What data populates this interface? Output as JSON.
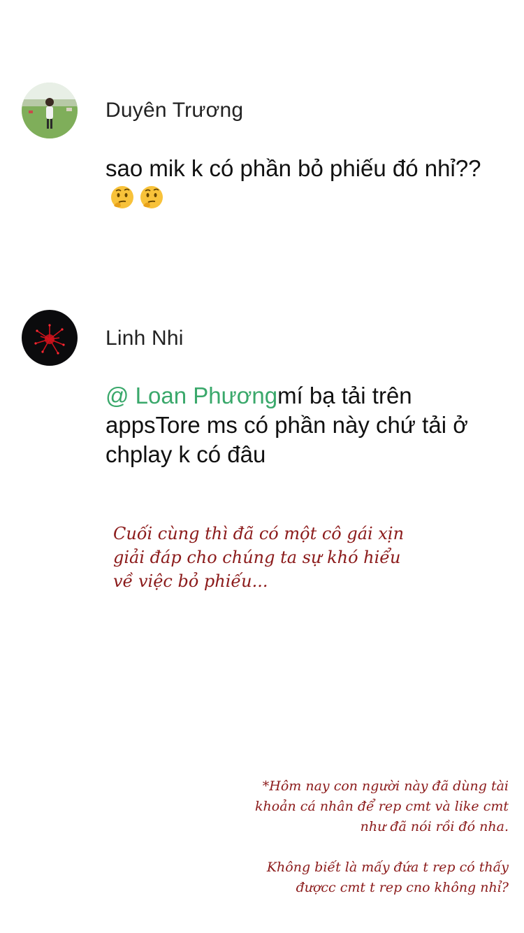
{
  "comments": [
    {
      "author": "Duyên Trương",
      "text": "sao mik k có phần bỏ phiếu đó nhỉ??",
      "emojis": [
        "thinking-face",
        "thinking-face"
      ]
    },
    {
      "author": "Linh Nhi",
      "mention": "@ Loan Phương",
      "text": "mí bạ tải trên appsTore ms có phần này chứ tải ở chplay k có đâu"
    }
  ],
  "caption": {
    "line1": "Cuối cùng thì đã có một cô gái xịn",
    "line2": "giải đáp cho chúng ta sự khó hiểu",
    "line3": "về việc bỏ phiếu..."
  },
  "note": {
    "line1": "*Hôm nay con người này đã dùng tài",
    "line2": "khoản cá nhân để rep cmt và like cmt",
    "line3": "như đã nói rồi đó nha.",
    "line4": "Không biết là mấy đứa t rep có thấy",
    "line5": "đượcc cmt t rep cno không nhỉ?"
  },
  "colors": {
    "mention": "#3aa86b",
    "caption": "#8b1a1a"
  }
}
